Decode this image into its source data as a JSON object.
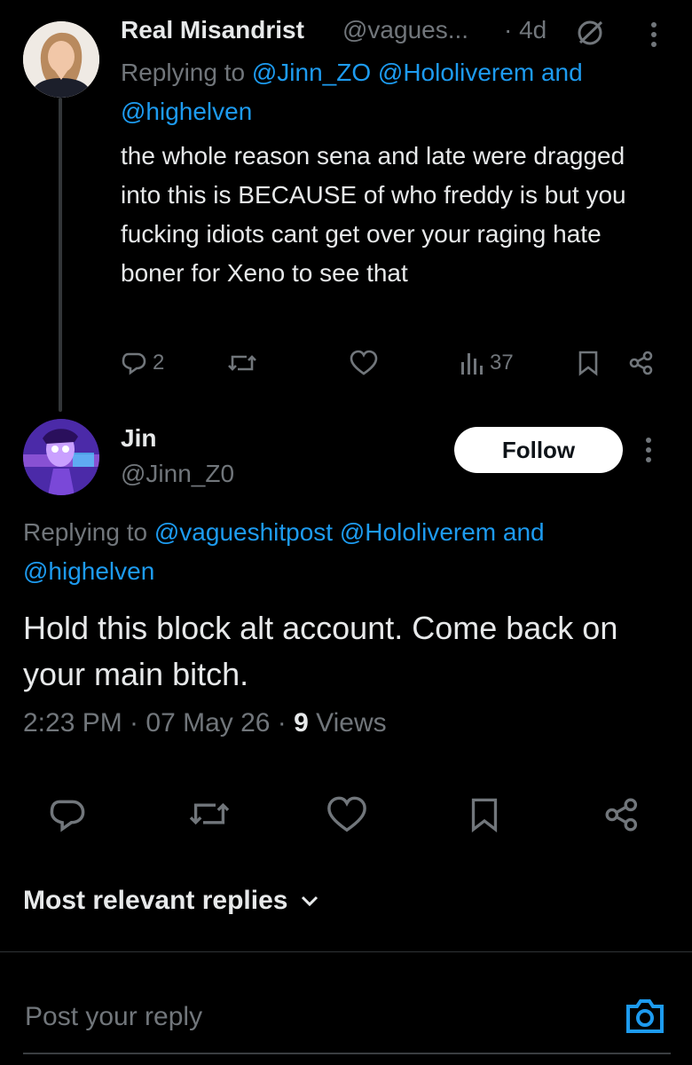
{
  "tweet1": {
    "display_name": "Real Misandrist",
    "handle": "@vagues...",
    "time": "· 4d",
    "replying_prefix": "Replying to",
    "reply_mentions": [
      "@Jinn_ZO",
      "@Hololiverem"
    ],
    "reply_and": "and",
    "reply_last": "@highelven",
    "text": "the whole reason sena and late were dragged into this is BECAUSE of who freddy is but you fucking idiots cant get over your raging hate boner for Xeno to see that",
    "reply_count": "2",
    "views_count": "37"
  },
  "tweet2": {
    "display_name": "Jin",
    "handle": "@Jinn_Z0",
    "follow_label": "Follow",
    "replying_prefix": "Replying to",
    "reply_mentions": [
      "@vagueshitpost",
      "@Hololiverem"
    ],
    "reply_and": "and",
    "reply_last": "@highelven",
    "text": "Hold this block alt account. Come back on your main bitch.",
    "time": "2:23 PM · 07 May 26 · ",
    "views_num": "9",
    "views_label": " Views"
  },
  "sort_label": "Most relevant replies",
  "compose_placeholder": "Post your reply",
  "colors": {
    "background": "#000000",
    "text": "#e7e9ea",
    "muted": "#71767b",
    "link": "#1d9bf0",
    "divider": "#2f3336"
  },
  "icons": [
    "more-icon",
    "grok-icon",
    "reply-icon",
    "retweet-icon",
    "like-icon",
    "views-icon",
    "bookmark-icon",
    "share-icon",
    "chevron-down-icon",
    "camera-icon"
  ]
}
